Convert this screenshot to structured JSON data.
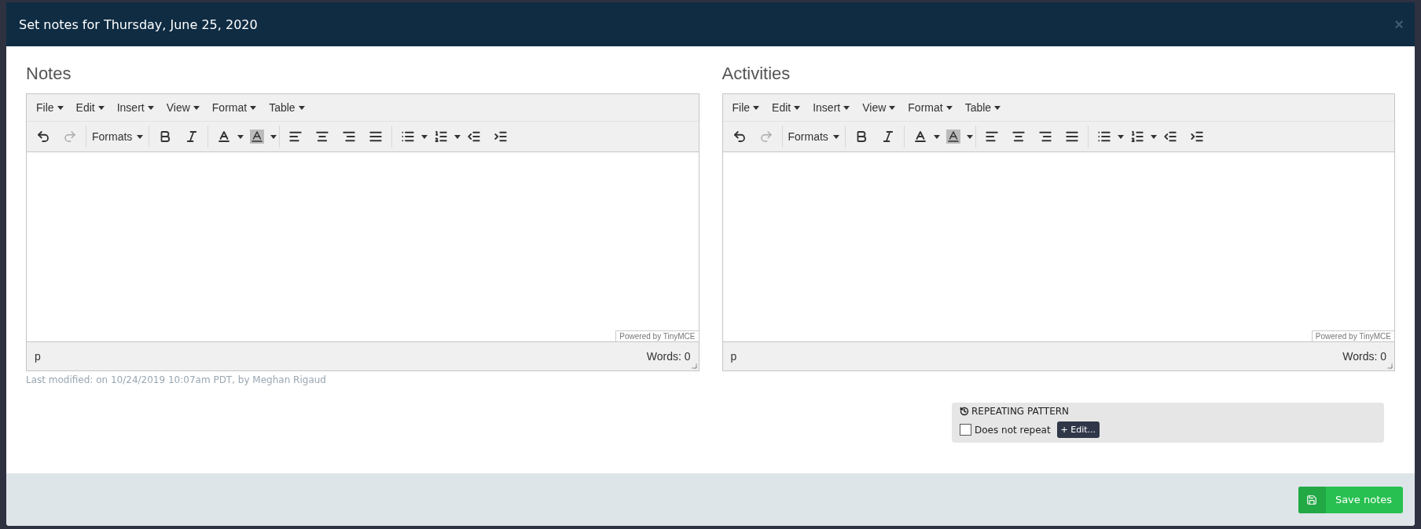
{
  "dialog": {
    "title": "Set notes for Thursday, June 25, 2020",
    "close": "×"
  },
  "editors": [
    {
      "title": "Notes",
      "menus": [
        "File",
        "Edit",
        "Insert",
        "View",
        "Format",
        "Table"
      ],
      "formats": "Formats",
      "powered": "Powered by TinyMCE",
      "path": "p",
      "words": "Words: 0",
      "note": "Last modified: on 10/24/2019 10:07am PDT, by Meghan Rigaud"
    },
    {
      "title": "Activities",
      "menus": [
        "File",
        "Edit",
        "Insert",
        "View",
        "Format",
        "Table"
      ],
      "formats": "Formats",
      "powered": "Powered by TinyMCE",
      "path": "p",
      "words": "Words: 0"
    }
  ],
  "repeating": {
    "title": "REPEATING PATTERN",
    "checked": false,
    "label": "Does not repeat",
    "edit": "+ Edit..."
  },
  "footer": {
    "save": "Save notes"
  }
}
